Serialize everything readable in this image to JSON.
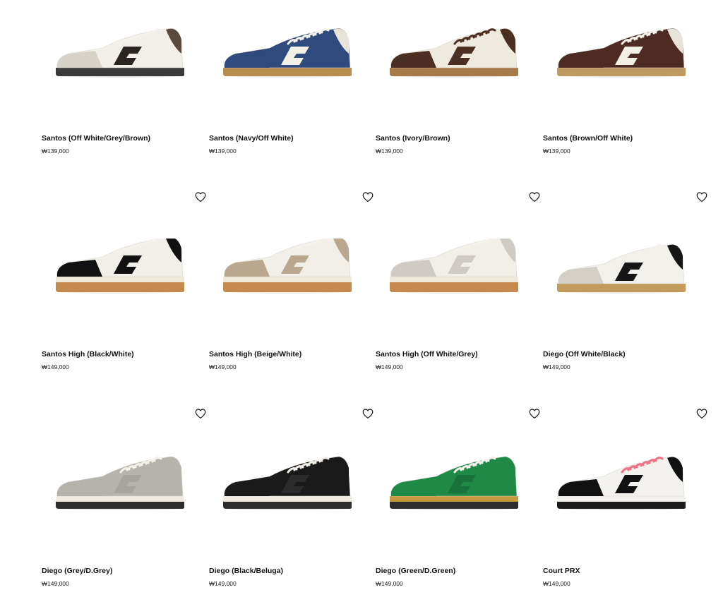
{
  "currency_symbol": "₩",
  "products": [
    {
      "name": "Santos (Off White/Grey/Brown)",
      "price": "₩139,000",
      "wishlist": false,
      "colors": {
        "upper": "#f2efe8",
        "accent": "#2a2522",
        "sole": "#3a3a3a",
        "toe": "#d8d3c9",
        "heel": "#5a4a3d",
        "lace": "#f4f1ea"
      }
    },
    {
      "name": "Santos (Navy/Off White)",
      "price": "₩139,000",
      "wishlist": false,
      "colors": {
        "upper": "#2f4a7c",
        "accent": "#f2efe6",
        "sole": "#b98d52",
        "toe": "#2f4a7c",
        "heel": "#e8e3d8",
        "lace": "#f4f1ea"
      }
    },
    {
      "name": "Santos (Ivory/Brown)",
      "price": "₩139,000",
      "wishlist": false,
      "colors": {
        "upper": "#efeadf",
        "accent": "#4a2f22",
        "sole": "#a87a48",
        "toe": "#4a2f22",
        "heel": "#4a2f22",
        "lace": "#4a2f22"
      }
    },
    {
      "name": "Santos (Brown/Off White)",
      "price": "₩139,000",
      "wishlist": false,
      "colors": {
        "upper": "#4d2a24",
        "accent": "#f2efe6",
        "sole": "#c09a60",
        "toe": "#4d2a24",
        "heel": "#e8e3d8",
        "lace": "#f4f1ea"
      }
    },
    {
      "name": "Santos High (Black/White)",
      "price": "₩149,000",
      "wishlist": true,
      "colors": {
        "upper": "#f2efe8",
        "accent": "#111111",
        "sole": "#c78a4e",
        "toe": "#111111",
        "heel": "#111111",
        "lace": "#f4f1ea",
        "midsole": "#efe9da"
      }
    },
    {
      "name": "Santos High (Beige/White)",
      "price": "₩149,000",
      "wishlist": true,
      "colors": {
        "upper": "#f2efe8",
        "accent": "#b9a88f",
        "sole": "#c78a4e",
        "toe": "#b9a88f",
        "heel": "#b9a88f",
        "lace": "#f4f1ea",
        "midsole": "#efe9da"
      }
    },
    {
      "name": "Santos High (Off White/Grey)",
      "price": "₩149,000",
      "wishlist": true,
      "colors": {
        "upper": "#f2efe8",
        "accent": "#cfcbc4",
        "sole": "#c78a4e",
        "toe": "#cfcbc4",
        "heel": "#cfcbc4",
        "lace": "#f4f1ea",
        "midsole": "#efe9da"
      }
    },
    {
      "name": "Diego (Off White/Black)",
      "price": "₩149,000",
      "wishlist": true,
      "colors": {
        "upper": "#f3f1ec",
        "accent": "#161616",
        "sole": "#c29a5c",
        "toe": "#d4cfc6",
        "heel": "#161616",
        "lace": "#f4f1ea"
      }
    },
    {
      "name": "Diego (Grey/D.Grey)",
      "price": "₩149,000",
      "wishlist": true,
      "colors": {
        "upper": "#b6b3ad",
        "accent": "#a8a59f",
        "sole": "#2d2d2d",
        "toe": "#b6b3ad",
        "heel": "#b6b3ad",
        "lace": "#f4f1ea",
        "midsole": "#f0ece2"
      }
    },
    {
      "name": "Diego (Black/Beluga)",
      "price": "₩149,000",
      "wishlist": true,
      "colors": {
        "upper": "#1a1a1a",
        "accent": "#2b2b2b",
        "sole": "#2d2d2d",
        "toe": "#1a1a1a",
        "heel": "#1a1a1a",
        "lace": "#f4f1ea",
        "midsole": "#f0ece2"
      }
    },
    {
      "name": "Diego (Green/D.Green)",
      "price": "₩149,000",
      "wishlist": true,
      "colors": {
        "upper": "#1f8a45",
        "accent": "#18733a",
        "sole": "#2d2d2d",
        "toe": "#1f8a45",
        "heel": "#1f8a45",
        "lace": "#f4f1ea",
        "midsole": "#c79a3f"
      }
    },
    {
      "name": "Court PRX",
      "price": "₩149,000",
      "wishlist": true,
      "colors": {
        "upper": "#f4f2ee",
        "accent": "#111111",
        "sole": "#1b1b1b",
        "toe": "#111111",
        "heel": "#111111",
        "lace": "#ef6f86",
        "midsole": "#f4f2ee"
      }
    }
  ]
}
